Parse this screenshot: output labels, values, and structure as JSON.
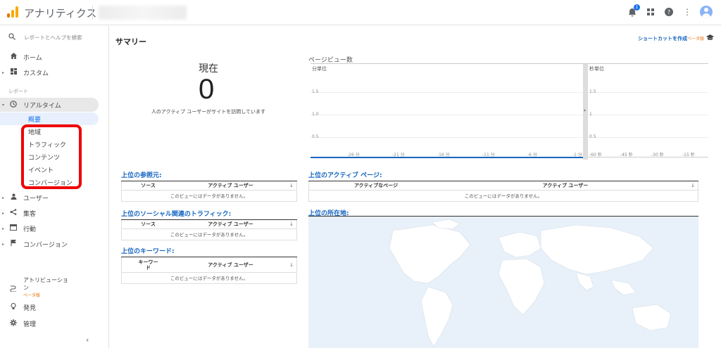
{
  "header": {
    "app_title": "アナリティクス",
    "notification_count": "1"
  },
  "sidebar": {
    "search_placeholder": "レポートとヘルプを検索",
    "home": "ホーム",
    "custom": "カスタム",
    "section_reports": "レポート",
    "realtime": "リアルタイム",
    "realtime_sub": [
      "概要",
      "地域",
      "トラフィック",
      "コンテンツ",
      "イベント",
      "コンバージョン"
    ],
    "audience": "ユーザー",
    "acquisition": "集客",
    "behavior": "行動",
    "conversions": "コンバージョン",
    "attribution_line1": "アトリビューショ",
    "attribution_line2": "ン",
    "attribution_beta": "ベータ版",
    "discover": "発見",
    "admin": "管理"
  },
  "main": {
    "summary_title": "サマリー",
    "shortcut": "ショートカットを作成",
    "shortcut_beta": "ベータ版",
    "now_label": "現在",
    "active_users": "0",
    "active_desc": "人のアクティブ ユーザーがサイトを訪問しています",
    "pageviews_title": "ページビュー数",
    "per_minute_label": "分単位",
    "per_second_label": "秒単位",
    "minute_yticks": [
      "1.5",
      "1.0",
      "0.5"
    ],
    "minute_xticks": [
      "-26 分",
      "-21 分",
      "-16 分",
      "-11 分",
      "-6 分",
      "-1 分"
    ],
    "second_yticks": [
      "1.5",
      "1",
      "0.5"
    ],
    "second_xticks": [
      "-60 秒",
      "-45 秒",
      "-30 秒",
      "-15 秒"
    ],
    "referrals_title": "上位の参照元:",
    "social_title": "上位のソーシャル関連のトラフィック:",
    "keywords_title": "上位のキーワード:",
    "active_pages_title": "上位のアクティブ ページ:",
    "locations_title": "上位の所在地:",
    "col_source": "ソース",
    "col_active_users": "アクティブ ユーザー",
    "col_keyword": "キーワー\nド",
    "col_active_page": "アクティブなページ",
    "no_data": "このビューにはデータがありません。"
  },
  "colors": {
    "accent": "#1565c0",
    "highlight": "#ee0000",
    "logo_orange": "#f9ab00",
    "logo_dark": "#e37400"
  }
}
